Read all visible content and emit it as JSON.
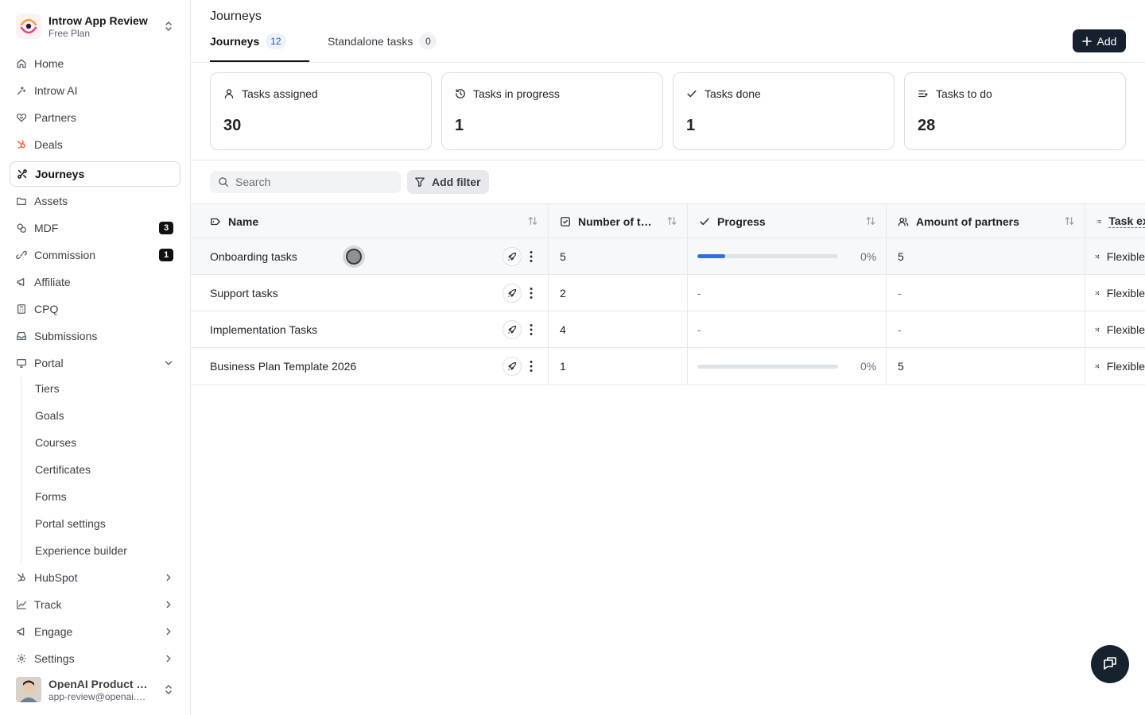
{
  "workspace": {
    "name": "Introw App Review",
    "plan": "Free Plan"
  },
  "nav": [
    {
      "id": "home",
      "label": "Home",
      "icon": "home-icon"
    },
    {
      "id": "introw-ai",
      "label": "Introw AI",
      "icon": "sparkle-icon"
    },
    {
      "id": "partners",
      "label": "Partners",
      "icon": "handshake-icon"
    },
    {
      "id": "deals",
      "label": "Deals",
      "icon": "hubspot-icon"
    },
    {
      "id": "journeys",
      "label": "Journeys",
      "icon": "journey-icon",
      "active": true
    },
    {
      "id": "assets",
      "label": "Assets",
      "icon": "folder-icon"
    },
    {
      "id": "mdf",
      "label": "MDF",
      "icon": "coins-icon",
      "badge": "3"
    },
    {
      "id": "commission",
      "label": "Commission",
      "icon": "link-icon",
      "badge": "1"
    },
    {
      "id": "affiliate",
      "label": "Affiliate",
      "icon": "megaphone-icon"
    },
    {
      "id": "cpq",
      "label": "CPQ",
      "icon": "calculator-icon"
    },
    {
      "id": "submissions",
      "label": "Submissions",
      "icon": "inbox-icon"
    },
    {
      "id": "portal",
      "label": "Portal",
      "icon": "monitor-icon"
    }
  ],
  "portal_sub": [
    "Tiers",
    "Goals",
    "Courses",
    "Certificates",
    "Forms",
    "Portal settings",
    "Experience builder"
  ],
  "nav_bottom": [
    {
      "id": "hubspot",
      "label": "HubSpot",
      "icon": "hubspot-icon"
    },
    {
      "id": "track",
      "label": "Track",
      "icon": "chart-icon"
    },
    {
      "id": "engage",
      "label": "Engage",
      "icon": "megaphone-icon"
    },
    {
      "id": "settings",
      "label": "Settings",
      "icon": "gear-icon"
    }
  ],
  "user": {
    "name": "OpenAI Product Review",
    "email": "app-review@openai.com"
  },
  "page": {
    "title": "Journeys"
  },
  "tabs": [
    {
      "label": "Journeys",
      "count": "12"
    },
    {
      "label": "Standalone tasks",
      "count": "0"
    }
  ],
  "add_button": "Add",
  "stats": [
    {
      "label": "Tasks assigned",
      "value": "30",
      "icon": "user-icon"
    },
    {
      "label": "Tasks in progress",
      "value": "1",
      "icon": "clock-icon"
    },
    {
      "label": "Tasks done",
      "value": "1",
      "icon": "check-icon"
    },
    {
      "label": "Tasks to do",
      "value": "28",
      "icon": "list-icon"
    }
  ],
  "search": {
    "placeholder": "Search"
  },
  "filter_button": "Add filter",
  "table": {
    "columns": [
      "Name",
      "Number of tasks",
      "Progress",
      "Amount of partners",
      "Task execution"
    ],
    "rows": [
      {
        "name": "Onboarding tasks",
        "tasks": "5",
        "progress": 0.2,
        "progress_label": "0%",
        "partners": "5",
        "execution": "Flexible"
      },
      {
        "name": "Support tasks",
        "tasks": "2",
        "progress": null,
        "progress_label": "-",
        "partners": "-",
        "execution": "Flexible"
      },
      {
        "name": "Implementation Tasks",
        "tasks": "4",
        "progress": null,
        "progress_label": "-",
        "partners": "-",
        "execution": "Flexible"
      },
      {
        "name": "Business Plan Template 2026",
        "tasks": "1",
        "progress": 0,
        "progress_label": "0%",
        "partners": "5",
        "execution": "Flexible"
      }
    ]
  },
  "colors": {
    "accent": "#2f6fe4",
    "primary_button": "#16202e",
    "badge": "#111111",
    "count_text": "#2d56c7"
  }
}
